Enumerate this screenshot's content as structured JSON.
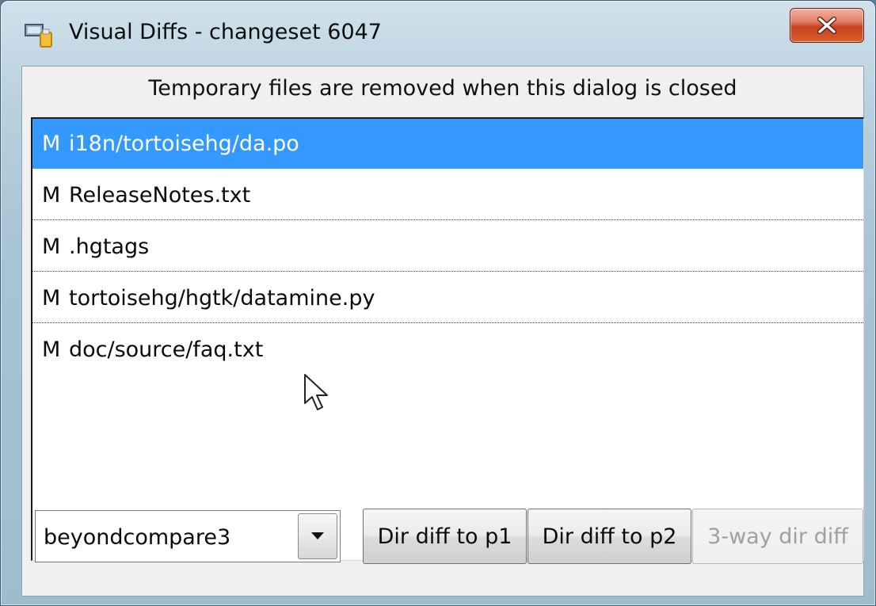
{
  "window": {
    "title": "Visual Diffs - changeset 6047",
    "close_icon": "close-x-icon"
  },
  "notice": "Temporary files are removed when this dialog is closed",
  "files": [
    {
      "status": "M",
      "path": "i18n/tortoisehg/da.po",
      "selected": true
    },
    {
      "status": "M",
      "path": "ReleaseNotes.txt",
      "selected": false
    },
    {
      "status": "M",
      "path": ".hgtags",
      "selected": false
    },
    {
      "status": "M",
      "path": "tortoisehg/hgtk/datamine.py",
      "selected": false
    },
    {
      "status": "M",
      "path": "doc/source/faq.txt",
      "selected": false
    }
  ],
  "tool_select": {
    "value": "beyondcompare3"
  },
  "buttons": {
    "dir_diff_p1": "Dir diff to p1",
    "dir_diff_p2": "Dir diff to p2",
    "three_way": "3-way dir diff"
  },
  "colors": {
    "selection": "#3399ff",
    "disabled_text": "#a0a0a0"
  }
}
